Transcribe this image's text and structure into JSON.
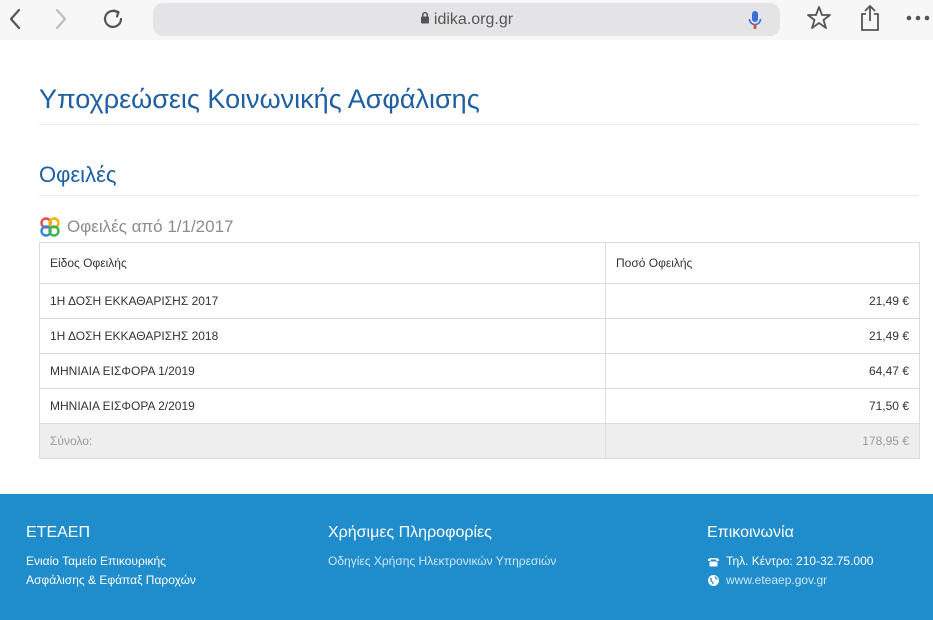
{
  "browser": {
    "url": "idika.org.gr",
    "back_icon": "chevron-left-icon",
    "forward_icon": "chevron-right-icon",
    "reload_icon": "reload-icon",
    "lock_icon": "lock-icon",
    "mic_icon": "microphone-icon",
    "bookmark_icon": "star-icon",
    "share_icon": "share-icon",
    "more_icon": "more-dots-icon"
  },
  "page": {
    "title": "Υποχρεώσεις Κοινωνικής Ασφάλισης",
    "section_title": "Οφειλές",
    "subtitle": "Οφειλές από 1/1/2017",
    "subtitle_icon": "efka-logo-icon"
  },
  "table": {
    "headers": [
      "Είδος Οφειλής",
      "Ποσό Οφειλής"
    ],
    "rows": [
      {
        "type": "1Η ΔΟΣΗ ΕΚΚΑΘΑΡΙΣΗΣ 2017",
        "amount": "21,49 €"
      },
      {
        "type": "1Η ΔΟΣΗ ΕΚΚΑΘΑΡΙΣΗΣ 2018",
        "amount": "21,49 €"
      },
      {
        "type": "ΜΗΝΙΑΙΑ ΕΙΣΦΟΡΑ 1/2019",
        "amount": "64,47 €"
      },
      {
        "type": "ΜΗΝΙΑΙΑ ΕΙΣΦΟΡΑ 2/2019",
        "amount": "71,50 €"
      }
    ],
    "total_label": "Σύνολο:",
    "total_amount": "178,95 €"
  },
  "footer": {
    "col1": {
      "heading": "ΕΤΕΑΕΠ",
      "line1": "Ενιαίο Ταμείο Επικουρικής",
      "line2": "Ασφάλισης & Εφάπαξ Παροχών"
    },
    "col2": {
      "heading": "Χρήσιμες Πληροφορίες",
      "link": "Οδηγίες Χρήσης Ηλεκτρονικών Υπηρεσιών"
    },
    "col3": {
      "heading": "Επικοινωνία",
      "phone": "Τηλ. Κέντρο: 210-32.75.000",
      "website": "www.eteaep.gov.gr",
      "phone_icon": "phone-icon",
      "web_icon": "globe-icon"
    }
  },
  "colors": {
    "primary_text": "#1f5fa3",
    "footer_bg": "#1f8dcb",
    "table_border": "#dcdcdc",
    "total_bg": "#eeeeee"
  }
}
